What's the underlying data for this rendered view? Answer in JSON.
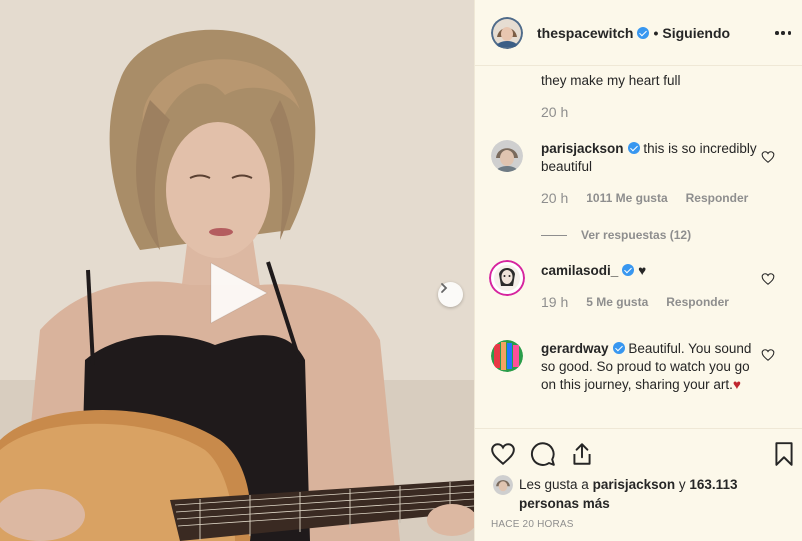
{
  "post": {
    "author": "thespacewitch",
    "follow_status": "Siguiendo",
    "separator": "•"
  },
  "comments": [
    {
      "text": "they make my heart full",
      "time": "20 h"
    },
    {
      "user": "parisjackson",
      "text": "this is so incredibly beautiful",
      "time": "20 h",
      "likes": "1011 Me gusta",
      "reply": "Responder",
      "view_replies": "Ver respuestas (12)"
    },
    {
      "user": "camilasodi_",
      "text": "♥",
      "time": "19 h",
      "likes": "5 Me gusta",
      "reply": "Responder"
    },
    {
      "user": "gerardway",
      "text": "Beautiful. You sound so good. So proud to watch you go on this journey, sharing your art.",
      "emoji": "♥"
    }
  ],
  "likes_summary": {
    "prefix": "Les gusta a",
    "user": "parisjackson",
    "middle": "y",
    "count": "163.113 personas más"
  },
  "posted_ago": "HACE 20 HORAS",
  "colors": {
    "background": "#fcf8ea",
    "verified": "#3897f0",
    "heart_red": "#ed4956",
    "muted": "#8e8e8e"
  },
  "icons": [
    "play-icon",
    "chevron-right-icon",
    "more-icon",
    "heart-icon",
    "comment-icon",
    "share-icon",
    "bookmark-icon",
    "verified-icon"
  ]
}
